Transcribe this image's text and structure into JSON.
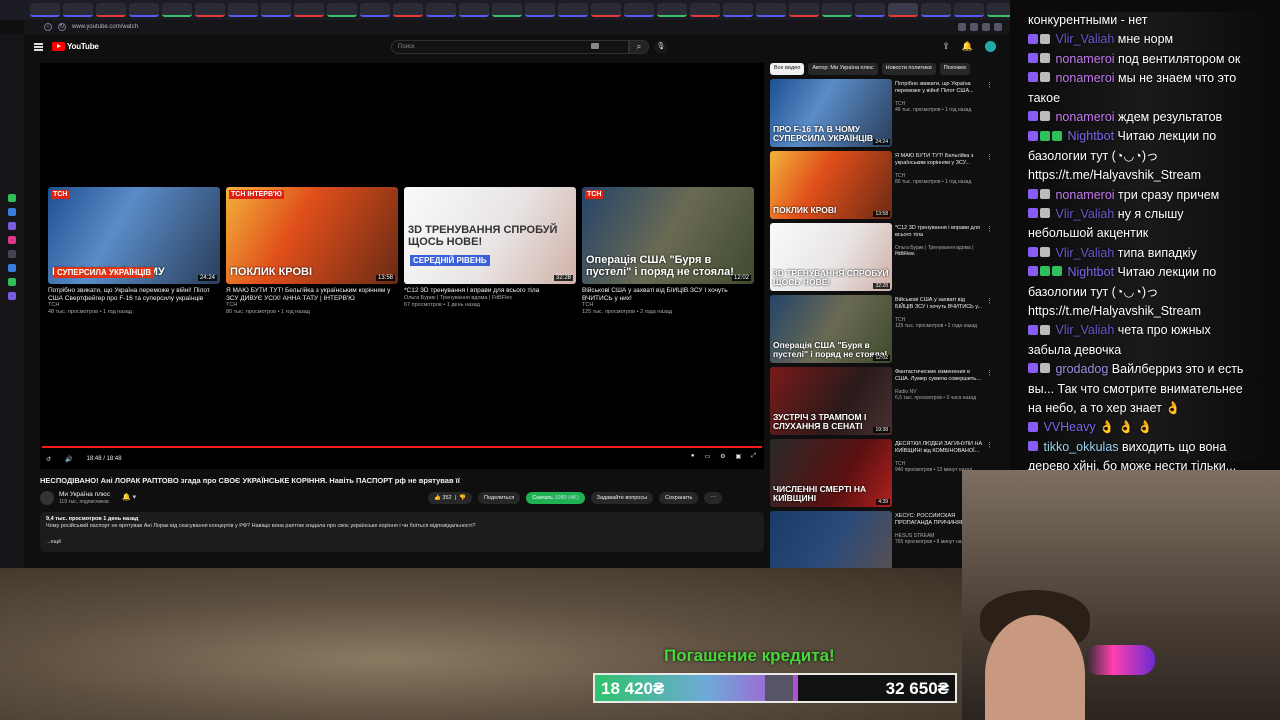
{
  "browser": {
    "url": "www.youtube.com/watch"
  },
  "youtube": {
    "logo": "YouTube",
    "search_placeholder": "Поиск",
    "player": {
      "time": "18:48 / 18:48",
      "progress": 1.0,
      "endcards": [
        {
          "tag": "ТСН",
          "caption": "ПРО F-16 ТА В ЧОМУ",
          "caption2": "СУПЕРСИЛА УКРАЇНЦІВ",
          "duration": "24:24",
          "title": "Потрібно звикати, що Україна переможе у війні! Пілот США Свертфейгер про F-16 та суперсилу українців",
          "channel": "ТСН",
          "meta": "48 тыс. просмотров • 1 год назад"
        },
        {
          "tag": "ТСН ІНТЕРВ'Ю",
          "caption": "ПОКЛИК КРОВІ",
          "caption2": "",
          "duration": "13:58",
          "title": "Я МАЮ БУТИ ТУТ! Бельгійка з українським корінням у ЗСУ ДИВУЄ УСІХ! АННА ТАТУ | ІНТЕРВ'Ю",
          "channel": "ТСН",
          "meta": "80 тыс. просмотров • 1 год назад"
        },
        {
          "tag": "",
          "caption": "3D ТРЕНУВАННЯ СПРОБУЙ ЩОСЬ НОВЕ!",
          "caption2": "СЕРЕДНІЙ РІВЕНЬ",
          "duration": "32:28",
          "title": "*С12 3D тренування і вправи для всього тіла",
          "channel": "Ольга Бурик | Тренування вдома | FitBFlex",
          "meta": "67 просмотров • 1 день назад"
        },
        {
          "tag": "ТСН",
          "caption": "Операція США \"Буря в пустелі\" і поряд не стояла!",
          "caption2": "",
          "duration": "12:02",
          "title": "Військові США у захваті від БІЙЦІВ ЗСУ І хочуть ВЧИТИСЬ у них!",
          "channel": "ТСН",
          "meta": "125 тыс. просмотров • 2 года назад"
        }
      ]
    },
    "video": {
      "title": "НЕСПОДІВАНО! Ані ЛОРАК РАПТОВО згада про СВОЄ УКРАЇНСЬКЕ КОРІННЯ. Навіть ПАСПОРТ рф не врятував її",
      "channel": "Ми Україна плюс",
      "subs": "119 тыс. подписчиков",
      "likes": "352",
      "share": "Поделиться",
      "download": "Скачать",
      "quality": "1080 (4K)",
      "ask": "Задавайте вопросы",
      "save": "Сохранить",
      "desc_stats": "9,4 тыс. просмотров  1 день назад",
      "desc_text": "Чому російський паспорт не врятував Ані Лорак від скасування концертів у РФ? Навіщо вона раптом згадала про своє українське коріння і чи боїться відповідальності?",
      "desc_more": "...ещё"
    },
    "chips": [
      "Все видео",
      "Автор: Ми Україна плюс",
      "Новости политики",
      "Похожее"
    ],
    "recs": [
      {
        "caption": "ПРО F-16 ТА В ЧОМУ СУПЕРСИЛА УКРАЇНЦІВ",
        "duration": "24:24",
        "title": "Потрібно звикати, що Україна переможе у війні! Пілот США...",
        "channel": "ТСН",
        "views": "48 тыс. просмотров • 1 год назад",
        "cls": "t1"
      },
      {
        "caption": "ПОКЛИК КРОВІ",
        "duration": "13:58",
        "title": "Я МАЮ БУТИ ТУТ! Бельгійка з українським корінням у ЗСУ...",
        "channel": "ТСН",
        "views": "80 тыс. просмотров • 1 год назад",
        "cls": "t2"
      },
      {
        "caption": "3D ТРЕНУВАННЯ СПРОБУЙ ЩОСЬ НОВЕ!",
        "duration": "32:28",
        "title": "*С12 3D тренування і вправи для всього тіла",
        "channel": "Ольга Бурик | Тренування вдома | FitBFlex",
        "views": "Новинка",
        "cls": "t3"
      },
      {
        "caption": "Операція США \"Буря в пустелі\" і поряд не стояла!",
        "duration": "12:02",
        "title": "Військові США у захваті від БІЙЦІВ ЗСУ і хочуть ВЧИТИСЬ у...",
        "channel": "ТСН",
        "views": "125 тыс. просмотров • 2 года назад",
        "cls": "t4"
      },
      {
        "caption": "ЗУСТРІЧ З ТРАМПОМ І СЛУХАННЯ В СЕНАТІ",
        "duration": "19:38",
        "title": "Фантастические изменения в США. Лумер сумела совершить...",
        "channel": "Radio NV",
        "views": "6,5 тыс. просмотров • 3 часа назад",
        "cls": "r5"
      },
      {
        "caption": "ЧИСЛЕННІ СМЕРТІ НА КИЇВЩИНІ",
        "duration": "4:39",
        "title": "ДЕСЯТКИ ЛЮДЕЙ ЗАГИНУЛИ НА КИЇВЩИНІ від КОМБІНОВАНОЇ...",
        "channel": "ТСН",
        "views": "940 просмотров • 13 минут назад",
        "cls": "r6"
      },
      {
        "caption": "",
        "duration": "",
        "title": "ХЕСУС: РОССИЙСКАЯ ПРОПАГАНДА ПРИЧИНЯЕТ...",
        "channel": "HESUS STREAM",
        "views": "765 просмотров • 8 минут назад",
        "cls": "r7"
      }
    ]
  },
  "chat": [
    {
      "user": "",
      "text": "конкурентными - нет",
      "cls": "",
      "badges": []
    },
    {
      "user": "Vlir_Valiah",
      "text": "мне норм",
      "cls": "u1",
      "badges": [
        "p",
        "w"
      ]
    },
    {
      "user": "nonameroi",
      "text": "под вентилятором ок",
      "cls": "u2",
      "badges": [
        "p",
        "w"
      ]
    },
    {
      "user": "nonameroi",
      "text": "мы не знаем что это",
      "cls": "u2",
      "badges": [
        "p",
        "w"
      ]
    },
    {
      "user": "",
      "text": "такое",
      "cls": "",
      "badges": []
    },
    {
      "user": "nonameroi",
      "text": "ждем результатов",
      "cls": "u2",
      "badges": [
        "p",
        "w"
      ]
    },
    {
      "user": "Nightbot",
      "text": "Читаю лекции по",
      "cls": "u3",
      "badges": [
        "p",
        "g",
        "g"
      ]
    },
    {
      "user": "",
      "text": "базологии тут (◔◡◔)っ",
      "cls": "",
      "badges": []
    },
    {
      "user": "",
      "text": "https://t.me/Halyavshik_Stream",
      "cls": "",
      "badges": []
    },
    {
      "user": "nonameroi",
      "text": "три сразу причем",
      "cls": "u2",
      "badges": [
        "p",
        "w"
      ]
    },
    {
      "user": "Vlir_Valiah",
      "text": "ну я слышу",
      "cls": "u1",
      "badges": [
        "p",
        "w"
      ]
    },
    {
      "user": "",
      "text": "небольшой акцентик",
      "cls": "",
      "badges": []
    },
    {
      "user": "Vlir_Valiah",
      "text": "типа випадкіу",
      "cls": "u1",
      "badges": [
        "p",
        "w"
      ]
    },
    {
      "user": "Nightbot",
      "text": "Читаю лекции по",
      "cls": "u3",
      "badges": [
        "p",
        "g",
        "g"
      ]
    },
    {
      "user": "",
      "text": "базологии тут (◔◡◔)っ",
      "cls": "",
      "badges": []
    },
    {
      "user": "",
      "text": "https://t.me/Halyavshik_Stream",
      "cls": "",
      "badges": []
    },
    {
      "user": "Vlir_Valiah",
      "text": "чета про южных",
      "cls": "u1",
      "badges": [
        "p",
        "w"
      ]
    },
    {
      "user": "",
      "text": "забыла девочка",
      "cls": "",
      "badges": []
    },
    {
      "user": "grodadog",
      "text": "Вайлберриз это и есть",
      "cls": "u4",
      "badges": [
        "p",
        "w"
      ]
    },
    {
      "user": "",
      "text": "вы... Так что смотрите внимательнее",
      "cls": "",
      "badges": []
    },
    {
      "user": "",
      "text": "на небо, а то хер знает 👌",
      "cls": "",
      "badges": []
    },
    {
      "user": "VVHeavy",
      "text": "👌 👌 👌",
      "cls": "u3",
      "badges": [
        "p"
      ]
    },
    {
      "user": "tikko_okkulas",
      "text": "виходить що вона",
      "cls": "u5",
      "badges": [
        "p"
      ]
    },
    {
      "user": "",
      "text": "дерево хйні, бо може нести тільки...",
      "cls": "",
      "badges": []
    }
  ],
  "stream": {
    "credit_title": "Погашение кредита!",
    "credit_current": "18 420₴",
    "credit_goal": "32 650₴",
    "credit_progress": 0.564
  }
}
